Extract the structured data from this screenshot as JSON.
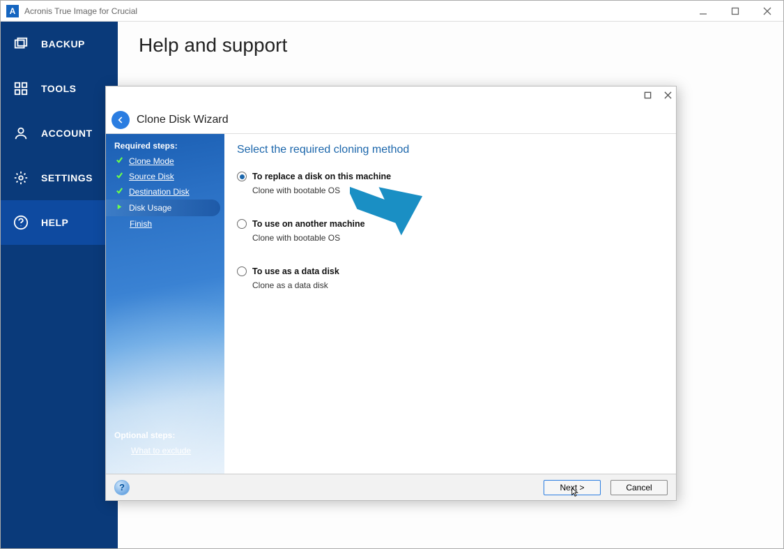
{
  "app": {
    "title": "Acronis True Image for Crucial",
    "icon_letter": "A"
  },
  "sidebar": {
    "items": [
      {
        "label": "BACKUP"
      },
      {
        "label": "TOOLS"
      },
      {
        "label": "ACCOUNT"
      },
      {
        "label": "SETTINGS"
      },
      {
        "label": "HELP"
      }
    ]
  },
  "page": {
    "heading": "Help and support"
  },
  "wizard": {
    "title": "Clone Disk Wizard",
    "required_header": "Required steps:",
    "optional_header": "Optional steps:",
    "steps": {
      "clone_mode": "Clone Mode",
      "source_disk": "Source Disk",
      "destination_disk": "Destination Disk",
      "disk_usage": "Disk Usage",
      "finish": "Finish"
    },
    "optional": {
      "what_to_exclude": "What to exclude"
    },
    "content_heading": "Select the required cloning method",
    "options": [
      {
        "title": "To replace a disk on this machine",
        "subtitle": "Clone with bootable OS",
        "selected": true
      },
      {
        "title": "To use on another machine",
        "subtitle": "Clone with bootable OS",
        "selected": false
      },
      {
        "title": "To use as a data disk",
        "subtitle": "Clone as a data disk",
        "selected": false
      }
    ],
    "buttons": {
      "next": "Next >",
      "cancel": "Cancel"
    },
    "help_glyph": "?"
  }
}
